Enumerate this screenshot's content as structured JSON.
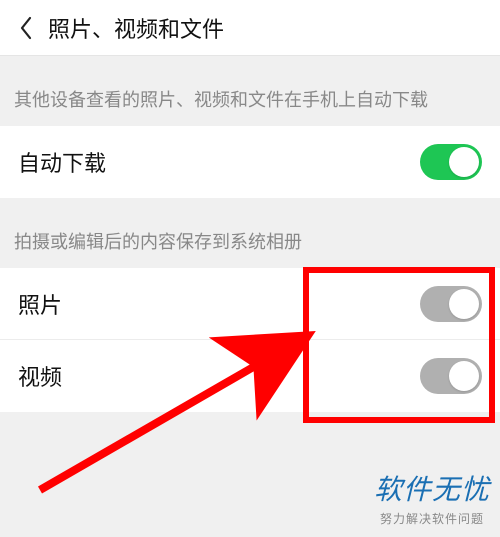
{
  "header": {
    "title": "照片、视频和文件"
  },
  "sections": {
    "autoDownload": {
      "header": "其他设备查看的照片、视频和文件在手机上自动下载",
      "row": {
        "label": "自动下载",
        "enabled": true
      }
    },
    "saveToGallery": {
      "header": "拍摄或编辑后的内容保存到系统相册",
      "rows": {
        "photo": {
          "label": "照片",
          "enabled": false
        },
        "video": {
          "label": "视频",
          "enabled": false
        }
      }
    }
  },
  "annotation": {
    "highlightColor": "#ff0000"
  },
  "watermark": {
    "main": "软件无忧",
    "sub": "努力解决软件问题"
  }
}
